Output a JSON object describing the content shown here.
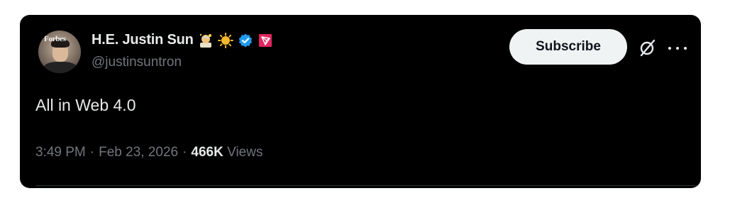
{
  "author": {
    "display_name": "H.E. Justin Sun",
    "handle": "@justinsuntron",
    "avatar_text": "Forbes",
    "badges": [
      "astronaut-emoji-icon",
      "sun-emoji-icon",
      "verified-badge-icon",
      "tron-logo-icon"
    ]
  },
  "actions": {
    "subscribe_label": "Subscribe",
    "grok_icon": "grok-icon",
    "more_icon": "more-options-icon"
  },
  "tweet": {
    "text": "All in Web 4.0"
  },
  "meta": {
    "time": "3:49 PM",
    "separator": "·",
    "date": "Feb 23, 2026",
    "views_count": "466K",
    "views_label": "Views"
  },
  "colors": {
    "background": "#000000",
    "primary_text": "#e7e9ea",
    "secondary_text": "#71767b",
    "verified_blue": "#1d9bf0",
    "tron_red": "#e0245e"
  }
}
